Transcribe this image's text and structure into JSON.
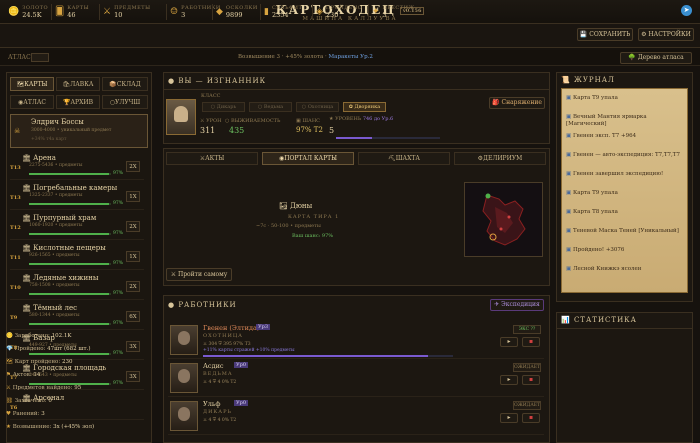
{
  "header": {
    "title": "КАРТОХОДЕЦ",
    "version": "v0.156",
    "subtitle": "МАШИНА КАЛЛУУВА",
    "telegram": "telegram-icon"
  },
  "stats": [
    {
      "label": "ЗОЛОТО",
      "value": "24.5K",
      "icon": "gold-icon"
    },
    {
      "label": "КАРТЫ",
      "value": "46",
      "icon": "cards-icon"
    },
    {
      "label": "ПРЕДМЕТЫ",
      "value": "10",
      "icon": "items-icon"
    },
    {
      "label": "РАБОТНИКИ",
      "value": "3",
      "icon": "workers-icon"
    },
    {
      "label": "ОСКОЛКИ",
      "value": "9899",
      "icon": "shards-icon"
    },
    {
      "label": "СУЛЬФИТ",
      "value": "2354",
      "icon": "sulfite-icon"
    },
    {
      "label": "ПРОЙДЕНО",
      "value": "230",
      "icon": "passed-icon"
    },
    {
      "label": "ПРЕСТИЖ",
      "value": "3",
      "icon": "prestige-icon"
    }
  ],
  "buttons": {
    "save": "СОХРАНИТЬ",
    "settings": "НАСТРОЙКИ",
    "atlas_tree": "Дерево атласа"
  },
  "atlasbar": {
    "label": "АТЛАС:",
    "text": "Возвышение 3 · +45% золота ·",
    "link": "Маракеты Ур.2"
  },
  "left_tabs": {
    "maps": "КАРТЫ",
    "shop": "ЛАВКА",
    "storage": "СКЛАД",
    "atlas": "АТЛАС",
    "archive": "АРХИВ",
    "upgrade": "УЛУЧШ"
  },
  "boss": {
    "name": "Элдрич Боссы",
    "info": "3000-4000 • уникальный предмет",
    "extra": "+34% т4а карт"
  },
  "locations": [
    {
      "tier": "T13",
      "name": "Арена",
      "info": "2275-5436 • предметы",
      "pct": "97%",
      "mult": "2X",
      "fill": 97
    },
    {
      "tier": "T13",
      "name": "Погребальные камеры",
      "info": "1325-2337 • предметы",
      "pct": "97%",
      "mult": "1X",
      "fill": 97
    },
    {
      "tier": "T12",
      "name": "Пурпурный храм",
      "info": "1060-1920 • предметы",
      "pct": "97%",
      "mult": "2X",
      "fill": 97
    },
    {
      "tier": "T11",
      "name": "Кислотные пещеры",
      "info": "926-1565 • предметы",
      "pct": "97%",
      "mult": "1X",
      "fill": 97
    },
    {
      "tier": "T10",
      "name": "Ледяные хижины",
      "info": "758-1508 • предметы",
      "pct": "97%",
      "mult": "2X",
      "fill": 97
    },
    {
      "tier": "T9",
      "name": "Тёмный лес",
      "info": "580-1344 • предметы",
      "pct": "97%",
      "mult": "6X",
      "fill": 97
    },
    {
      "tier": "T8",
      "name": "Базар",
      "info": "449-927 • предметы",
      "pct": "97%",
      "mult": "3X",
      "fill": 97
    },
    {
      "tier": "T7",
      "name": "Городская площадь",
      "info": "349-643 • предметы",
      "pct": "97%",
      "mult": "3X",
      "fill": 97
    },
    {
      "tier": "T6",
      "name": "Арсенал",
      "info": "",
      "pct": "",
      "mult": "",
      "fill": 0
    }
  ],
  "hero": {
    "title": "ВЫ — ИЗГНАННИК",
    "class_label": "КЛАСС",
    "classes": [
      "Дикарь",
      "Ведьма",
      "Охотница",
      "Дворянка"
    ],
    "active_class": "Дворянка",
    "respec": "Снаряжение",
    "damage_label": "УРОН",
    "damage": "311",
    "survival_label": "ВЫЖИВАЕМОСТЬ",
    "survival": "435",
    "chance_label": "ШАНС",
    "chance": "97% T2",
    "level_label": "УРОВЕНЬ",
    "level_info": "746 до Ур.6",
    "level": "5",
    "level_progress": 0.35
  },
  "portal_tabs": [
    "АКТЫ",
    "ПОРТАЛ КАРТЫ",
    "ШАХТА",
    "ДЕЛИРИУМ"
  ],
  "portal": {
    "map_name": "Дюны",
    "map_tier": "КАРТА ТИРА 1",
    "stats": "~7с  ·  50-100 • предметы",
    "chance": "Ваш шанс: 97%",
    "run_button": "Пройти самому"
  },
  "workers_panel": {
    "title": "РАБОТНИКИ",
    "expedition": "Экспедиция"
  },
  "workers": [
    {
      "name": "Гвенен (Элтида)",
      "level": "Ур3",
      "cls": "ОХОТНИЦА",
      "stats": "⚔ 304  ⛨ 395  97% T3",
      "bonus": "+11% карты стражей  +10% предметы",
      "status": "ЭКС ??",
      "progress": 0.9
    },
    {
      "name": "Асдис",
      "level": "Ур0",
      "cls": "ВЕДЬМА",
      "stats": "⚔ 4  ⛨ 4  0% T2",
      "bonus": "",
      "status": "ОЖИДАЕТ",
      "progress": 0
    },
    {
      "name": "Ульф",
      "level": "Ур0",
      "cls": "ДИКАРЬ",
      "stats": "⚔ 4  ⛨ 4  0% T2",
      "bonus": "",
      "status": "ОЖИДАЕТ",
      "progress": 0
    }
  ],
  "journal": {
    "title": "ЖУРНАЛ",
    "lines": [
      "Карта Т9 упала",
      "Вечный Мантия ярмарка [Магический]",
      "Гвенен эксп. Т7 +964",
      "Гвенен — авто-экспедиция: Т7,Т7,Т7",
      "Гвенен завершил экспедицию!",
      "Карта Т9 упала",
      "Карта Т8 упала",
      "Теневой Маска Теней [Уникальный]",
      "Пройдено! +3076",
      "Лесной Книжкэ ясолен"
    ]
  },
  "statistics": {
    "title": "СТАТИСТИКА",
    "rows": [
      {
        "label": "Заработано:",
        "value": "102.1K",
        "icon": "coins-icon"
      },
      {
        "label": "Пройдено:",
        "value": "47шт (682 шт.)",
        "icon": "gem-icon"
      },
      {
        "label": "Карт пройдено:",
        "value": "230",
        "icon": "map-icon"
      },
      {
        "label": "Актов:",
        "value": "14",
        "icon": "flag-icon"
      },
      {
        "label": "Предметов найдено:",
        "value": "95",
        "icon": "swords-icon"
      },
      {
        "label": "Захвачено:",
        "value": "0",
        "icon": "capture-icon"
      },
      {
        "label": "Ранений:",
        "value": "3",
        "icon": "heart-icon"
      },
      {
        "label": "Возвышение:",
        "value": "3x (+45% зол)",
        "icon": "star-icon"
      }
    ]
  }
}
